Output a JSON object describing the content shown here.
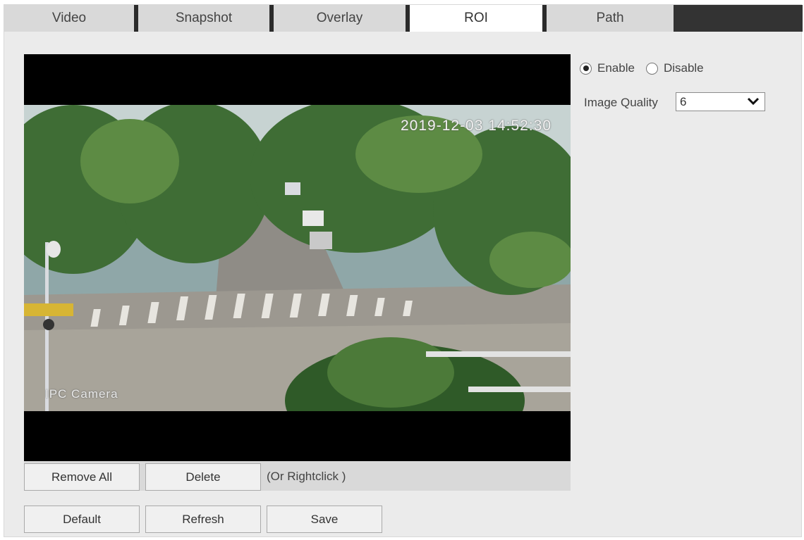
{
  "tabs": [
    {
      "label": "Video"
    },
    {
      "label": "Snapshot"
    },
    {
      "label": "Overlay"
    },
    {
      "label": "ROI",
      "active": true
    },
    {
      "label": "Path"
    }
  ],
  "video": {
    "timestamp": "2019-12-03 14:52:30",
    "channel_name": "IPC Camera"
  },
  "roi": {
    "enable_label": "Enable",
    "disable_label": "Disable",
    "selected": "Enable",
    "image_quality_label": "Image Quality",
    "image_quality_value": "6"
  },
  "toolbar": {
    "remove_all_label": "Remove All",
    "delete_label": "Delete",
    "hint": "(Or Rightclick )"
  },
  "actions": {
    "default_label": "Default",
    "refresh_label": "Refresh",
    "save_label": "Save"
  },
  "colors": {
    "active_tab": "#ffffff",
    "inactive_tab": "#d9d9d9",
    "panel_bg": "#ebebeb",
    "tab_separator": "#2b2b2b"
  }
}
